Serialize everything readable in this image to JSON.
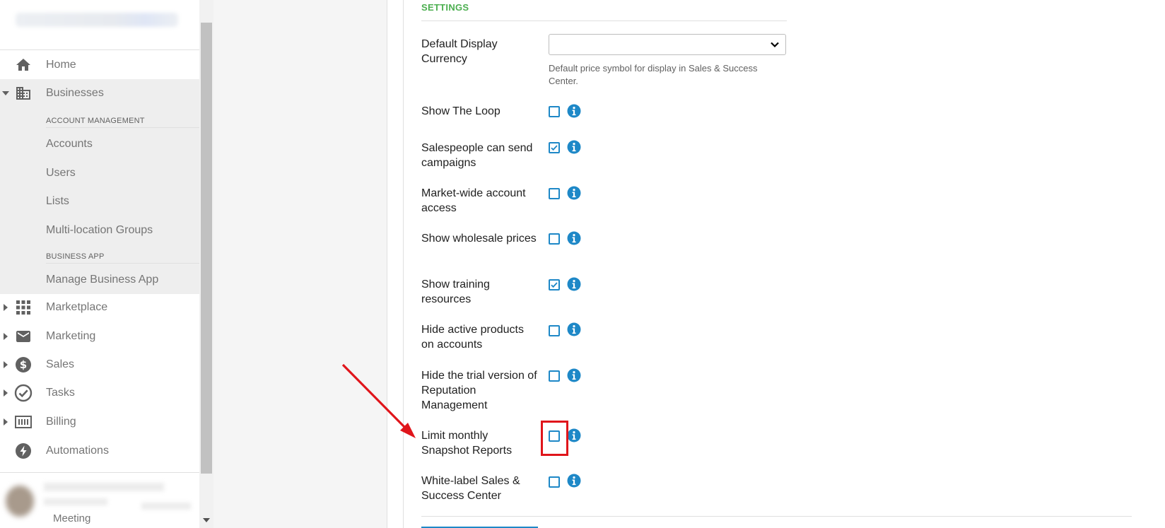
{
  "sidebar": {
    "nav": {
      "home": "Home",
      "businesses": "Businesses",
      "marketplace": "Marketplace",
      "marketing": "Marketing",
      "sales": "Sales",
      "tasks": "Tasks",
      "billing": "Billing",
      "automations": "Automations"
    },
    "account_management": {
      "header": "ACCOUNT MANAGEMENT",
      "items": [
        "Accounts",
        "Users",
        "Lists",
        "Multi-location Groups"
      ]
    },
    "business_app": {
      "header": "BUSINESS APP",
      "items": [
        "Manage Business App"
      ]
    },
    "user_partial_text": "Meeting"
  },
  "settings": {
    "title": "SETTINGS",
    "currency": {
      "label": "Default Display Currency",
      "value": "",
      "hint": "Default price symbol for display in Sales & Success Center."
    },
    "rows": [
      {
        "label": "Show The Loop",
        "checked": false
      },
      {
        "label": "Salespeople can send campaigns",
        "checked": true
      },
      {
        "label": "Market-wide account access",
        "checked": false
      },
      {
        "label": "Show wholesale prices",
        "checked": false
      },
      {
        "label": "Show training resources",
        "checked": true
      },
      {
        "label": "Hide active products on accounts",
        "checked": false
      },
      {
        "label": "Hide the trial version of Reputation Management",
        "checked": false
      },
      {
        "label": "Limit monthly Snapshot Reports",
        "checked": false
      },
      {
        "label": "White-label Sales & Success Center",
        "checked": false
      }
    ]
  },
  "colors": {
    "accent_green": "#4caf50",
    "checkbox_blue": "#1e88c7",
    "annotation_red": "#e0151b"
  },
  "icons": {
    "home": "home-icon",
    "businesses": "building-icon",
    "marketplace": "grid-icon",
    "marketing": "envelope-icon",
    "sales": "dollar-circle-icon",
    "tasks": "check-circle-icon",
    "billing": "billing-icon",
    "automations": "bolt-icon",
    "info": "info-icon"
  }
}
